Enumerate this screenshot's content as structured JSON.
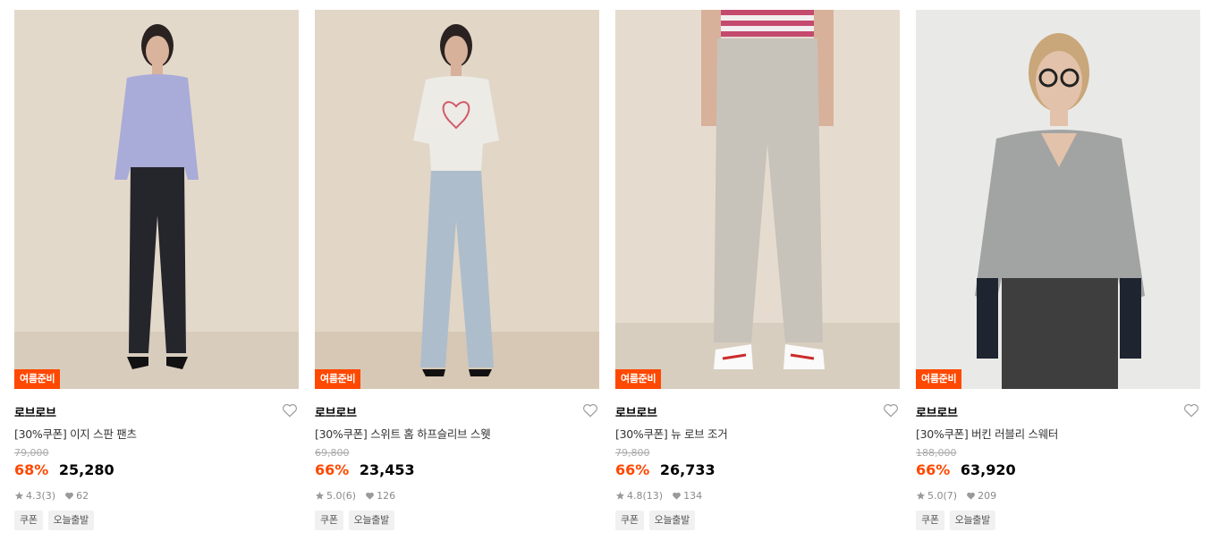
{
  "products": [
    {
      "badge": "여름준비",
      "brand": "로브로브",
      "name": "[30%쿠폰] 이지 스판 팬츠",
      "original_price": "79,000",
      "discount": "68%",
      "price": "25,280",
      "rating": "4.3",
      "reviews": "(3)",
      "likes": "62",
      "tags": [
        "쿠폰",
        "오늘출발"
      ],
      "image_icon": "model-photo-lavender-cardigan-black-pants",
      "colors": {
        "bg": "#e3d9ca",
        "top": "#a9abd8",
        "bottom": "#25252c"
      }
    },
    {
      "badge": "여름준비",
      "brand": "로브로브",
      "name": "[30%쿠폰] 스위트 홈 하프슬리브 스웻",
      "original_price": "69,800",
      "discount": "66%",
      "price": "23,453",
      "rating": "5.0",
      "reviews": "(6)",
      "likes": "126",
      "tags": [
        "쿠폰",
        "오늘출발"
      ],
      "image_icon": "model-photo-white-sweatshirt-light-jeans",
      "colors": {
        "bg": "#e2d6c6",
        "top": "#ecebe6",
        "bottom": "#aebdcb"
      }
    },
    {
      "badge": "여름준비",
      "brand": "로브로브",
      "name": "[30%쿠폰] 뉴 로브 조거",
      "original_price": "79,800",
      "discount": "66%",
      "price": "26,733",
      "rating": "4.8",
      "reviews": "(13)",
      "likes": "134",
      "tags": [
        "쿠폰",
        "오늘출발"
      ],
      "image_icon": "model-photo-grey-jogger-pants",
      "colors": {
        "bg": "#e5dccf",
        "top": "#c44a6e",
        "bottom": "#c7c2ba"
      }
    },
    {
      "badge": "여름준비",
      "brand": "로브로브",
      "name": "[30%쿠폰] 버킨 러블리 스웨터",
      "original_price": "188,000",
      "discount": "66%",
      "price": "63,920",
      "rating": "5.0",
      "reviews": "(7)",
      "likes": "209",
      "tags": [
        "쿠폰",
        "오늘출발"
      ],
      "image_icon": "model-photo-grey-knit-sweater",
      "colors": {
        "bg": "#e9e9e7",
        "top": "#a2a3a3",
        "bottom": "#3e3e3e"
      }
    }
  ],
  "colors": {
    "accent": "#ff4800",
    "muted": "#8a8a8a",
    "tag_bg": "#f1f1f1"
  }
}
